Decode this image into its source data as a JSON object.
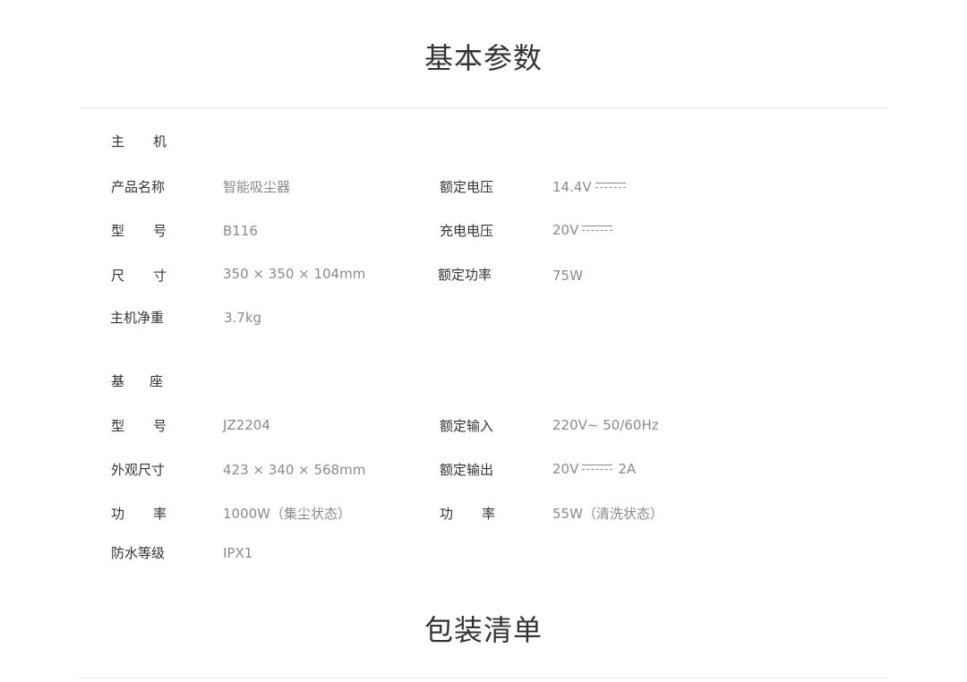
{
  "specs": {
    "title": "基本参数",
    "host": {
      "heading": [
        "主",
        "机"
      ],
      "name_label": "产品名称",
      "name_value": "智能吸尘器",
      "rated_voltage_label": "额定电压",
      "rated_voltage_value": "14.4V",
      "model_label": [
        "型",
        "号"
      ],
      "model_value": "B116",
      "charge_voltage_label": "充电电压",
      "charge_voltage_value": "20V",
      "size_label": [
        "尺",
        "寸"
      ],
      "size_value": "350 × 350 × 104mm",
      "rated_power_label": "额定功率",
      "rated_power_value": "75W",
      "weight_label": "主机净重",
      "weight_value": "3.7kg"
    },
    "base": {
      "heading": [
        "基",
        "座"
      ],
      "model_label": [
        "型",
        "号"
      ],
      "model_value": "JZ2204",
      "rated_input_label": "额定输入",
      "rated_input_value": "220V~ 50/60Hz",
      "size_label": "外观尺寸",
      "size_value": "423 × 340 × 568mm",
      "rated_output_label": "额定输出",
      "rated_output_value": "20V",
      "rated_output_current": "2A",
      "power_label": [
        "功",
        "率"
      ],
      "power_value": "1000W（集尘状态）",
      "power2_label": [
        "功",
        "率"
      ],
      "power2_value": "55W（清洗状态）",
      "waterproof_label": "防水等级",
      "waterproof_value": "IPX1"
    }
  },
  "package": {
    "title": "包装清单"
  },
  "colors": {
    "title": "#333333",
    "label": "#333333",
    "value": "#8a8a8a",
    "rule": "#ebebeb"
  }
}
